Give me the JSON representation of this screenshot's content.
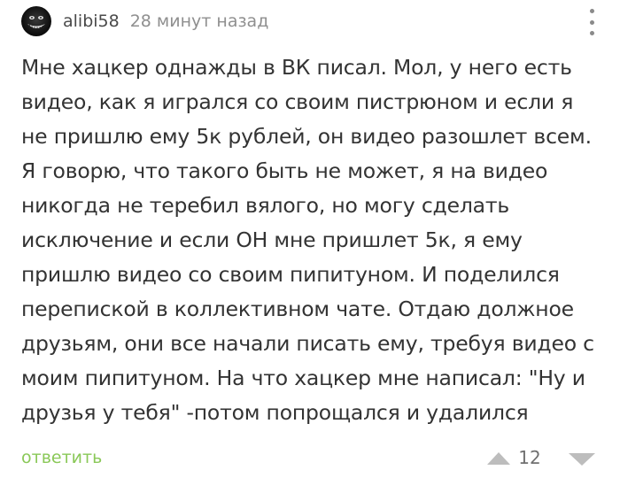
{
  "comment": {
    "author": "alibi58",
    "time": "28 минут назад",
    "text_lines": [
      "Мне хацкер однажды в ВК писал. Мол, у него есть",
      "видео, как я игрался со своим пистрюном и если я",
      "не пришлю ему 5к рублей, он видео разошлет всем.",
      "Я говорю, что такого быть не может, я на видео",
      "никогда не теребил вялого, но могу сделать",
      "исключение и если ОН мне пришлет 5к, я ему",
      "пришлю видео со своим пипитуном. И поделился",
      "перепиской в коллективном чате. Отдаю должное",
      "друзьям, они все начали писать ему, требуя видео с",
      "моим пипитуном. На что хацкер мне написал: \"Ну и",
      "друзья у тебя\" -потом попрощался и удалился"
    ],
    "reply_label": "ответить",
    "rating": "12"
  },
  "icons": {
    "avatar": "avatar-grin-icon",
    "more": "more-vertical-icon",
    "vote_up": "vote-up-icon",
    "vote_down": "vote-down-icon"
  },
  "colors": {
    "reply": "#8ac858",
    "text": "#333333",
    "meta": "#8f8f8f",
    "vote": "#bdbdbd"
  }
}
